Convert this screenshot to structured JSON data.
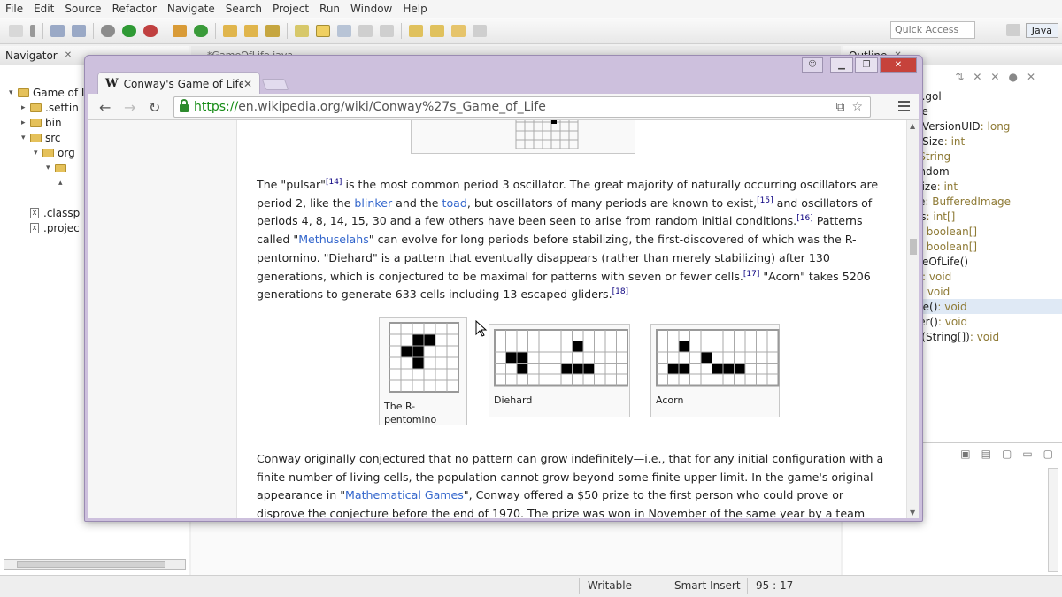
{
  "eclipse": {
    "menu": [
      "File",
      "Edit",
      "Source",
      "Refactor",
      "Navigate",
      "Search",
      "Project",
      "Run",
      "Window",
      "Help"
    ],
    "quick_access": "Quick Access",
    "perspective": "Java",
    "navigator": {
      "tab_label": "Navigator",
      "items": [
        {
          "label": "Game of L",
          "kind": "folder",
          "depth": 0,
          "arrow": "▾"
        },
        {
          "label": ".settin",
          "kind": "folder",
          "depth": 1,
          "arrow": "▸"
        },
        {
          "label": "bin",
          "kind": "folder",
          "depth": 1,
          "arrow": "▸"
        },
        {
          "label": "src",
          "kind": "folder",
          "depth": 1,
          "arrow": "▾"
        },
        {
          "label": "org",
          "kind": "folder",
          "depth": 2,
          "arrow": "▾"
        },
        {
          "label": "",
          "kind": "folder",
          "depth": 3,
          "arrow": "▾"
        },
        {
          "label": "",
          "kind": "none",
          "depth": 4,
          "arrow": "▴"
        },
        {
          "label": "",
          "kind": "none",
          "depth": 0,
          "arrow": ""
        },
        {
          "label": ".classp",
          "kind": "file",
          "depth": 1,
          "arrow": ""
        },
        {
          "label": ".projec",
          "kind": "file",
          "depth": 1,
          "arrow": ""
        }
      ]
    },
    "editor_tab": "*GameOfLife.java",
    "outline": {
      "tab_label": "Outline",
      "items": [
        {
          "name": "nst.gol",
          "type": ""
        },
        {
          "name": "fLife",
          "type": ""
        },
        {
          "name": "rialVersionUID",
          "type": " : long"
        },
        {
          "name": "meSize",
          "type": " : int"
        },
        {
          "name": "e",
          "type": " : String"
        },
        {
          "name": " Random",
          "type": ""
        },
        {
          "name": "idSize",
          "type": " : int"
        },
        {
          "name": "age",
          "type": " : BufferedImage"
        },
        {
          "name": "kels",
          "type": " : int[]"
        },
        {
          "name": "rid",
          "type": " : boolean[]"
        },
        {
          "name": "rid",
          "type": " : boolean[]"
        },
        {
          "name": "ameOfLife()",
          "type": ""
        },
        {
          "name": "rt()",
          "type": " : void"
        },
        {
          "name": "n()",
          "type": " : void"
        },
        {
          "name": "date()",
          "type": " : void"
        },
        {
          "name": "nder()",
          "type": " : void"
        },
        {
          "name": "ain(String[])",
          "type": " : void"
        }
      ]
    },
    "status": {
      "writable": "Writable",
      "insert_mode": "Smart Insert",
      "position": "95 : 17"
    }
  },
  "browser": {
    "tab_title": "Conway's Game of Life -",
    "tab_logo": "W",
    "url_scheme": "https://",
    "url_rest": "en.wikipedia.org/wiki/Conway%27s_Game_of_Life"
  },
  "article": {
    "p1": [
      {
        "t": "The \"pulsar\""
      },
      {
        "sup": "[14]"
      },
      {
        "t": " is the most common period 3 oscillator. The great majority of naturally occurring oscillators are period 2, like the "
      },
      {
        "a": "blinker"
      },
      {
        "t": " and the "
      },
      {
        "a": "toad"
      },
      {
        "t": ", but oscillators of many periods are known to exist,"
      },
      {
        "sup": "[15]"
      },
      {
        "t": " and oscillators of periods 4, 8, 14, 15, 30 and a few others have been seen to arise from random initial conditions."
      },
      {
        "sup": "[16]"
      },
      {
        "t": " Patterns called \""
      },
      {
        "a": "Methuselahs"
      },
      {
        "t": "\" can evolve for long periods before stabilizing, the first-discovered of which was the R-pentomino. \"Diehard\" is a pattern that eventually disappears (rather than merely stabilizing) after 130 generations, which is conjectured to be maximal for patterns with seven or fewer cells."
      },
      {
        "sup": "[17]"
      },
      {
        "t": " \"Acorn\" takes 5206 generations to generate 633 cells including 13 escaped gliders."
      },
      {
        "sup": "[18]"
      }
    ],
    "figures": [
      {
        "caption": "The R-pentomino",
        "cols": 6,
        "rows": 6,
        "cells": [
          [
            2,
            1
          ],
          [
            3,
            1
          ],
          [
            1,
            2
          ],
          [
            2,
            2
          ],
          [
            2,
            3
          ]
        ]
      },
      {
        "caption": "Diehard",
        "cols": 12,
        "rows": 5,
        "cells": [
          [
            7,
            1
          ],
          [
            1,
            2
          ],
          [
            2,
            2
          ],
          [
            2,
            3
          ],
          [
            6,
            3
          ],
          [
            7,
            3
          ],
          [
            8,
            3
          ]
        ]
      },
      {
        "caption": "Acorn",
        "cols": 11,
        "rows": 5,
        "cells": [
          [
            2,
            1
          ],
          [
            4,
            2
          ],
          [
            1,
            3
          ],
          [
            2,
            3
          ],
          [
            5,
            3
          ],
          [
            6,
            3
          ],
          [
            7,
            3
          ]
        ]
      }
    ],
    "p2": [
      {
        "t": "Conway originally conjectured that no pattern can grow indefinitely—i.e., that for any initial configuration with a finite number of living cells, the population cannot grow beyond some finite upper limit. In the game's original appearance in \""
      },
      {
        "a": "Mathematical Games"
      },
      {
        "t": "\", Conway offered a $50 prize to the first person who could prove or disprove the conjecture before the end of 1970. The prize was won in November of the same year by a team from the"
      }
    ]
  }
}
